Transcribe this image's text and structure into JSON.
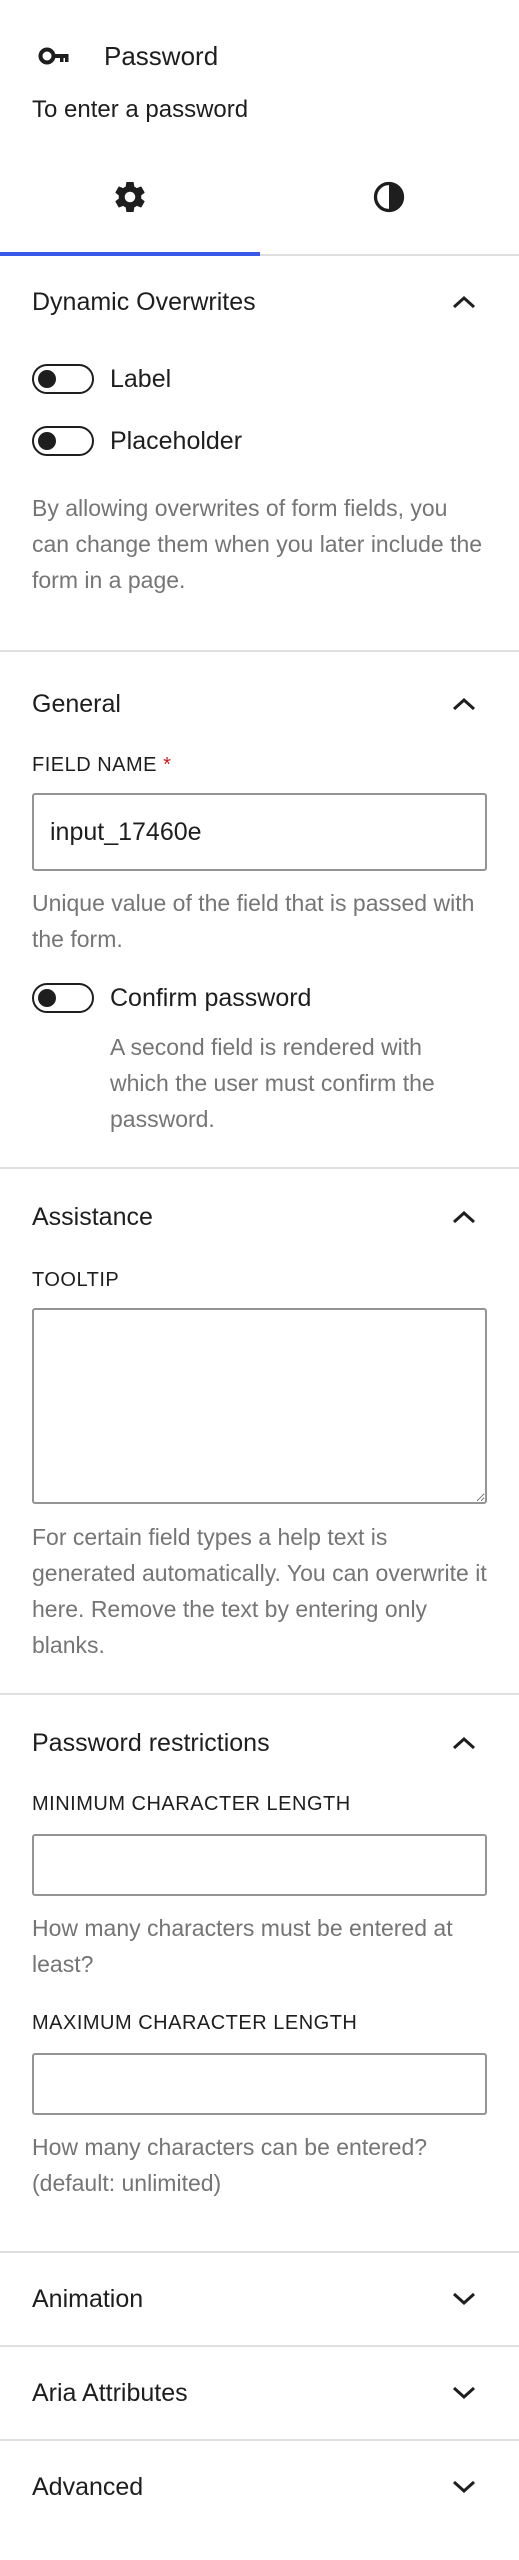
{
  "header": {
    "title": "Password",
    "description": "To enter a password",
    "icon": "key-icon"
  },
  "tabs": [
    {
      "name": "settings",
      "icon": "gear-icon",
      "active": true
    },
    {
      "name": "styles",
      "icon": "contrast-icon",
      "active": false
    }
  ],
  "dynamic_overwrites": {
    "title": "Dynamic Overwrites",
    "expanded": true,
    "toggle_label": "Label",
    "toggle_placeholder": "Placeholder",
    "help": "By allowing overwrites of form fields, you can change them when you later include the form in a page."
  },
  "general": {
    "title": "General",
    "expanded": true,
    "field_name_label": "FIELD NAME",
    "required_mark": "*",
    "field_name_value": "input_17460e",
    "field_name_help": "Unique value of the field that is passed with the form.",
    "confirm_label": "Confirm password",
    "confirm_help": "A second field is rendered with which the user must confirm the password."
  },
  "assistance": {
    "title": "Assistance",
    "expanded": true,
    "tooltip_label": "TOOLTIP",
    "tooltip_value": "",
    "help": "For certain field types a help text is generated automatically. You can overwrite it here. Remove the text by entering only blanks."
  },
  "password_restrictions": {
    "title": "Password restrictions",
    "expanded": true,
    "min_label": "MINIMUM CHARACTER LENGTH",
    "min_value": "",
    "min_help": "How many characters must be entered at least?",
    "max_label": "MAXIMUM CHARACTER LENGTH",
    "max_value": "",
    "max_help": "How many characters can be entered? (default: unlimited)"
  },
  "collapsed_panels": {
    "animation": "Animation",
    "aria": "Aria Attributes",
    "advanced": "Advanced"
  },
  "colors": {
    "accent": "#3858e9",
    "text": "#1e1e1e",
    "muted": "#757575",
    "required": "#cc1818",
    "border": "#e0e0e0"
  }
}
